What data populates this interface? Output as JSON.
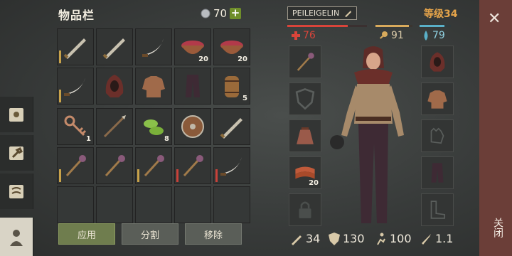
{
  "inventory": {
    "title": "物品栏",
    "coins": "70",
    "plus": "+"
  },
  "slots_top": [
    {
      "icon": "sword-icon",
      "qty": "",
      "dur": "gold"
    },
    {
      "icon": "sword-icon",
      "qty": "",
      "dur": ""
    },
    {
      "icon": "scimitar-icon",
      "qty": "",
      "dur": ""
    },
    {
      "icon": "berry-bowl-icon",
      "qty": "20",
      "dur": ""
    },
    {
      "icon": "berry-bowl-icon",
      "qty": "20",
      "dur": ""
    },
    {
      "icon": "scimitar-icon",
      "qty": "",
      "dur": "gold"
    },
    {
      "icon": "hood-icon",
      "qty": "",
      "dur": ""
    },
    {
      "icon": "jacket-icon",
      "qty": "",
      "dur": ""
    },
    {
      "icon": "pants-icon",
      "qty": "",
      "dur": ""
    },
    {
      "icon": "barrel-icon",
      "qty": "5",
      "dur": ""
    }
  ],
  "slots_bottom": [
    {
      "icon": "key-icon",
      "qty": "1",
      "dur": ""
    },
    {
      "icon": "spear-icon",
      "qty": "",
      "dur": ""
    },
    {
      "icon": "cactus-slices-icon",
      "qty": "8",
      "dur": ""
    },
    {
      "icon": "round-shield-icon",
      "qty": "",
      "dur": ""
    },
    {
      "icon": "sword-icon",
      "qty": "",
      "dur": ""
    },
    {
      "icon": "mace-icon",
      "qty": "",
      "dur": "gold"
    },
    {
      "icon": "mace-icon",
      "qty": "",
      "dur": ""
    },
    {
      "icon": "mace-icon",
      "qty": "",
      "dur": "gold"
    },
    {
      "icon": "mace-icon",
      "qty": "",
      "dur": "red"
    },
    {
      "icon": "scimitar-icon",
      "qty": "",
      "dur": "red"
    },
    {
      "icon": "",
      "qty": "",
      "dur": ""
    },
    {
      "icon": "",
      "qty": "",
      "dur": ""
    },
    {
      "icon": "",
      "qty": "",
      "dur": ""
    },
    {
      "icon": "",
      "qty": "",
      "dur": ""
    },
    {
      "icon": "",
      "qty": "",
      "dur": ""
    }
  ],
  "buttons": {
    "apply": "应用",
    "split": "分割",
    "remove": "移除"
  },
  "character": {
    "name": "PEILEIGELIN",
    "level": "等级34",
    "health": "76",
    "hunger": "91",
    "thirst": "79",
    "health_fill": 0.76,
    "hunger_fill": 0.91,
    "thirst_fill": 0.79,
    "armor": "34",
    "defense": "130",
    "speed": "100",
    "damage": "1.1",
    "left_equip": [
      {
        "icon": "mace-icon",
        "qty": ""
      },
      {
        "icon": "shield-outline-icon",
        "qty": ""
      },
      {
        "icon": "bag-icon",
        "qty": ""
      },
      {
        "icon": "bacon-icon",
        "qty": "20"
      },
      {
        "icon": "lock-icon",
        "qty": ""
      }
    ],
    "right_equip": [
      {
        "icon": "hood-icon"
      },
      {
        "icon": "jacket-icon"
      },
      {
        "icon": "gloves-outline-icon"
      },
      {
        "icon": "pants-icon"
      },
      {
        "icon": "boots-outline-icon"
      }
    ]
  },
  "close": {
    "x": "✕",
    "label": "关闭"
  },
  "colors": {
    "health": "#d9443a",
    "hunger": "#d8aa5c",
    "thirst": "#5ab0c8",
    "level": "#e5a44a",
    "close_bg": "#6b3e38"
  }
}
